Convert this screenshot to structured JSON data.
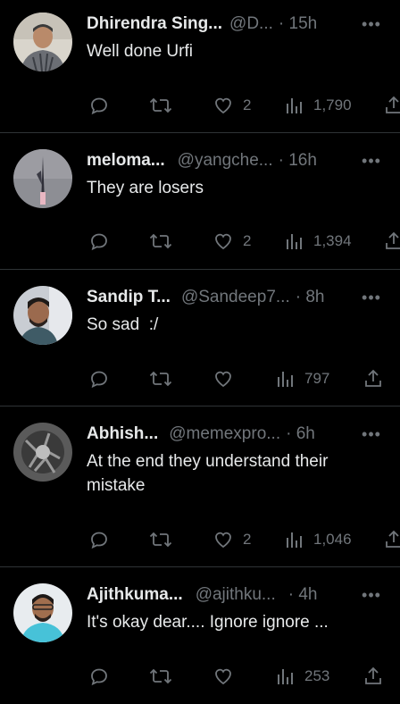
{
  "tweets": [
    {
      "name": "Dhirendra Sing...",
      "handle": "@D...",
      "time": "· 15h",
      "text": "Well done Urfi",
      "likes": "2",
      "views": "1,790"
    },
    {
      "name": "meloma...",
      "handle": "@yangche...",
      "time": "· 16h",
      "text": "They are losers",
      "likes": "2",
      "views": "1,394"
    },
    {
      "name": "Sandip T...",
      "handle": "@Sandeep7...",
      "time": "· 8h",
      "text": "So sad  :/",
      "likes": "",
      "views": "797"
    },
    {
      "name": "Abhish...",
      "handle": "@memexpro...",
      "time": "· 6h",
      "text": "At the end they understand their mistake",
      "likes": "2",
      "views": "1,046"
    },
    {
      "name": "Ajithkuma...",
      "handle": "@ajithku...",
      "time": "· 4h",
      "text": "It's okay dear.... Ignore ignore ...",
      "likes": "",
      "views": "253"
    }
  ],
  "icons": {
    "more": "more-icon",
    "reply": "reply-icon",
    "retweet": "retweet-icon",
    "like": "heart-icon",
    "views": "views-icon",
    "share": "share-icon"
  },
  "colors": {
    "background": "#000000",
    "text": "#e7e9ea",
    "muted": "#71767b",
    "divider": "#2f3336"
  }
}
